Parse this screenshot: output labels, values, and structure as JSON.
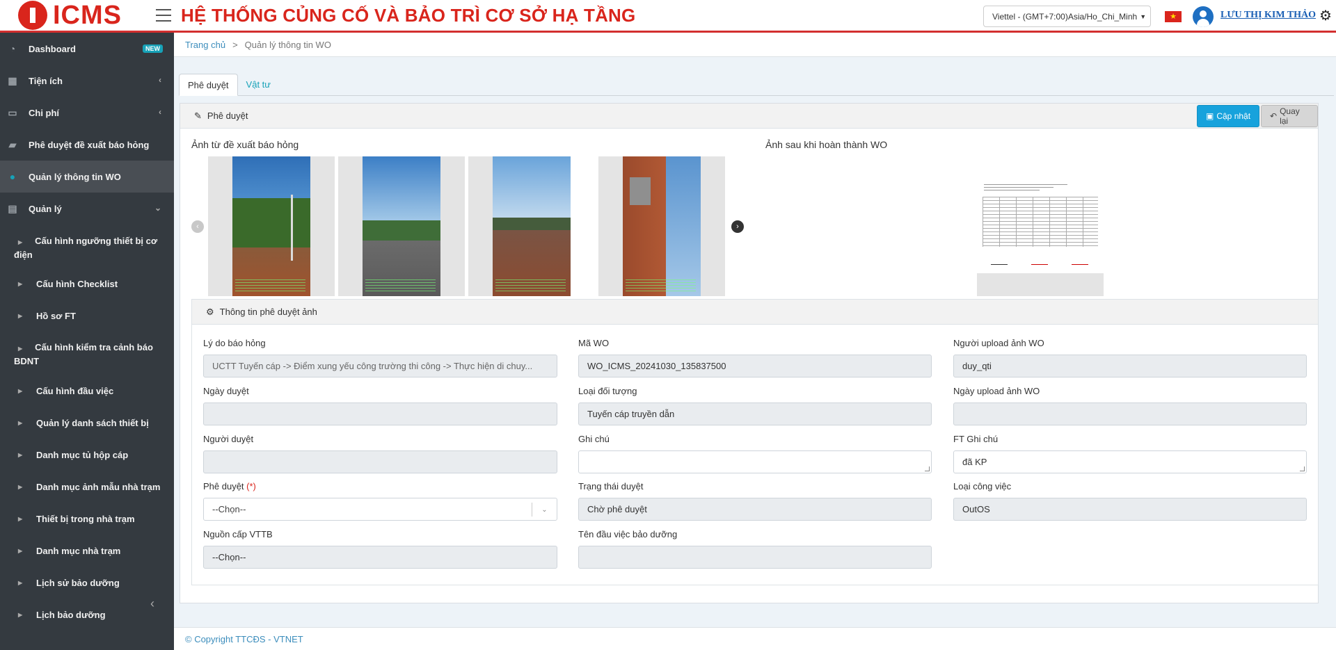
{
  "header": {
    "logo_text": "ICMS",
    "system_title": "HỆ THỐNG CỦNG CỐ VÀ BẢO TRÌ CƠ SỞ HẠ TẦNG",
    "timezone": "Viettel - (GMT+7:00)Asia/Ho_Chi_Minh",
    "user_name": "LƯU THỊ KIM THẢO",
    "flag_star": "★"
  },
  "sidebar": {
    "items": [
      {
        "label": "Dashboard",
        "badge": "NEW"
      },
      {
        "label": "Tiện ích"
      },
      {
        "label": "Chi phí"
      },
      {
        "label": "Phê duyệt đề xuất báo hỏng"
      },
      {
        "label": "Quản lý thông tin WO"
      },
      {
        "label": "Quản lý"
      }
    ],
    "sub_items": [
      "Cấu hình ngưỡng thiết bị cơ điện",
      "Cấu hình Checklist",
      "Hồ sơ FT",
      "Cấu hình kiểm tra cảnh báo BDNT",
      "Cấu hình đầu việc",
      "Quản lý danh sách thiết bị",
      "Danh mục tủ hộp cáp",
      "Danh mục ảnh mẫu nhà trạm",
      "Thiết bị trong nhà trạm",
      "Danh mục nhà trạm",
      "Lịch sử bảo dưỡng",
      "Lịch bảo dưỡng"
    ]
  },
  "breadcrumb": {
    "home": "Trang chủ",
    "sep": ">",
    "current": "Quản lý thông tin WO"
  },
  "tabs": [
    "Phê duyệt",
    "Vật tư"
  ],
  "card": {
    "title": "Phê duyệt",
    "update_label": "Cập nhật",
    "back_label": "Quay lại"
  },
  "gallery": {
    "before_title": "Ảnh từ đề xuất báo hỏng",
    "after_title": "Ảnh sau khi hoàn thành WO"
  },
  "approval": {
    "title": "Thông tin phê duyệt ảnh",
    "fields": {
      "ly_do_label": "Lý do báo hỏng",
      "ly_do_value": "UCTT Tuyến cáp -> Điểm xung yếu công trường thi công -> Thực hiện di chuy...",
      "ma_wo_label": "Mã WO",
      "ma_wo_value": "WO_ICMS_20241030_135837500",
      "nguoi_upload_label": "Người upload ảnh WO",
      "nguoi_upload_value": "duy_qti",
      "ngay_duyet_label": "Ngày duyệt",
      "ngay_duyet_value": "",
      "loai_doi_tuong_label": "Loại đối tượng",
      "loai_doi_tuong_value": "Tuyến cáp truyền dẫn",
      "ngay_upload_label": "Ngày upload ảnh WO",
      "ngay_upload_value": "",
      "nguoi_duyet_label": "Người duyệt",
      "nguoi_duyet_value": "",
      "ghi_chu_label": "Ghi chú",
      "ghi_chu_value": "",
      "ft_ghi_chu_label": "FT Ghi chú",
      "ft_ghi_chu_value": "đã KP",
      "phe_duyet_label": "Phê duyệt",
      "phe_duyet_required": "(*)",
      "phe_duyet_value": "--Chọn--",
      "trang_thai_label": "Trạng thái duyệt",
      "trang_thai_value": "Chờ phê duyệt",
      "loai_cong_viec_label": "Loại công việc",
      "loai_cong_viec_value": "OutOS",
      "nguon_cap_label": "Nguồn cấp VTTB",
      "nguon_cap_value": "--Chọn--",
      "ten_dau_viec_label": "Tên đầu việc bảo dưỡng",
      "ten_dau_viec_value": ""
    }
  },
  "footer": {
    "copyright": "© Copyright TTCĐS - VTNET"
  }
}
